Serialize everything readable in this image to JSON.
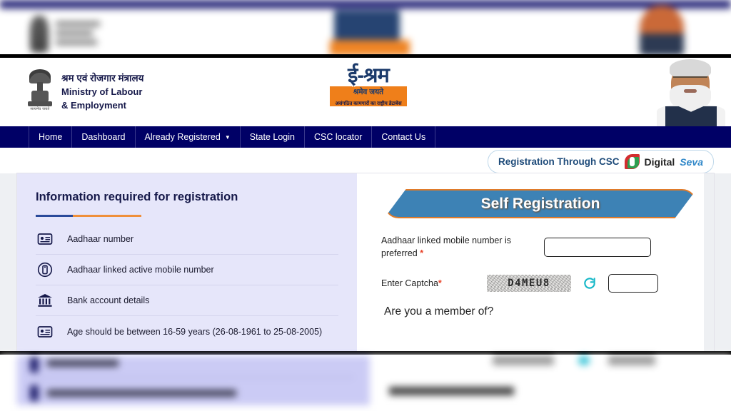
{
  "header": {
    "ministry_hindi": "श्रम एवं रोजगार मंत्रालय",
    "ministry_en_line1": "Ministry of Labour",
    "ministry_en_line2": "& Employment",
    "emblem_motto": "सत्यमेव जयते",
    "logo_main": "ई-श्रम",
    "logo_sub": "श्रमेव जयते",
    "logo_tagline": "असंगठित कामगारों का राष्ट्रीय डेटाबेस"
  },
  "nav": {
    "items": [
      {
        "label": "Home"
      },
      {
        "label": "Dashboard"
      },
      {
        "label": "Already Registered",
        "caret": "▼"
      },
      {
        "label": "State Login"
      },
      {
        "label": "CSC locator"
      },
      {
        "label": "Contact Us"
      }
    ]
  },
  "csc_banner": {
    "text": "Registration Through CSC",
    "digital": "Digital",
    "seva": "Seva"
  },
  "left_panel": {
    "title": "Information required for registration",
    "items": [
      {
        "icon": "id-card-icon",
        "label": "Aadhaar number"
      },
      {
        "icon": "mobile-phone-icon",
        "label": "Aadhaar linked active mobile number"
      },
      {
        "icon": "bank-icon",
        "label": "Bank account details"
      },
      {
        "icon": "id-card-icon",
        "label": "Age should be between 16-59 years (26-08-1961 to 25-08-2005)"
      }
    ]
  },
  "right_panel": {
    "banner_title": "Self Registration",
    "mobile_label": "Aadhaar linked mobile number is preferred",
    "required_mark": "*",
    "mobile_value": "",
    "mobile_placeholder": "",
    "captcha_label": "Enter Captcha",
    "captcha_text": "D4MEU8",
    "captcha_value": "",
    "refresh_icon": "refresh-icon",
    "member_question": "Are you a member of?"
  },
  "colors": {
    "navy": "#000066",
    "lavender": "#e6e6fa",
    "steel_blue": "#3d82b5",
    "orange": "#e07b2a",
    "required_red": "#e8442a",
    "cyan": "#17b8c8"
  }
}
